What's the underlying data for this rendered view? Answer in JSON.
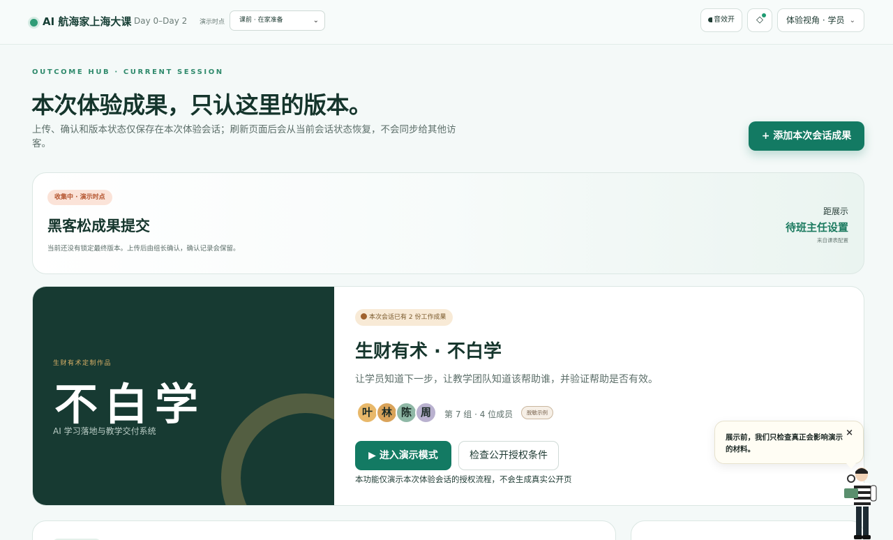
{
  "header": {
    "brand_title": "AI 航海家上海大课",
    "brand_days": "Day 0–Day 2",
    "timepoint_label": "演示时点",
    "timepoint_value": "课前 · 在家准备",
    "sound_label": "音效开",
    "role_label": "体验视角 · 学员"
  },
  "hero": {
    "eyebrow": "OUTCOME HUB · CURRENT SESSION",
    "title": "本次体验成果，只认这里的版本。",
    "subtitle": "上传、确认和版本状态仅保存在本次体验会话；刷新页面后会从当前会话状态恢复，不会同步给其他访客。",
    "add_button": "+ 添加本次会话成果"
  },
  "collect": {
    "badge": "收集中 · 演示时点",
    "title": "黑客松成果提交",
    "desc": "当前还没有锁定最终版本。上传后由组长确认，确认记录会保留。",
    "countdown_label": "距展示",
    "countdown_value": "待班主任设置",
    "countdown_source": "来自课表配置"
  },
  "feature": {
    "cover_kicker": "生财有术定制作品",
    "cover_title": "不白学",
    "cover_sub": "AI 学习落地与教学交付系统",
    "badge": "本次会话已有 2 份工作成果",
    "title": "生财有术 · 不白学",
    "desc": "让学员知道下一步，让教学团队知道该帮助谁，并验证帮助是否有效。",
    "members": [
      {
        "name": "叶",
        "color": "#e8b86a"
      },
      {
        "name": "林",
        "color": "#d9a35a"
      },
      {
        "name": "陈",
        "color": "#8fb8a6"
      },
      {
        "name": "周",
        "color": "#b9b1cf"
      }
    ],
    "team": "第 7 组 · 4 位成员",
    "sample_tag": "脱敏示例",
    "demo_button": "▶ 进入演示模式",
    "license_button": "检查公开授权条件",
    "demo_note": "本功能仅演示本次体验会话的授权流程，不会生成真实公开页"
  },
  "tooltip": {
    "text": "展示前，我们只检查真正会影响演示的材料。",
    "close": "×"
  },
  "icons": {
    "status_dot": "status-dot-icon",
    "sound": "sound-icon",
    "diamond": "diamond-icon",
    "chevron": "chevron-down-icon",
    "play": "play-icon"
  },
  "colors": {
    "accent": "#137a63",
    "cover_bg": "#173a32",
    "badge_bg": "#fbe3d8",
    "badge_text": "#b4552f"
  }
}
